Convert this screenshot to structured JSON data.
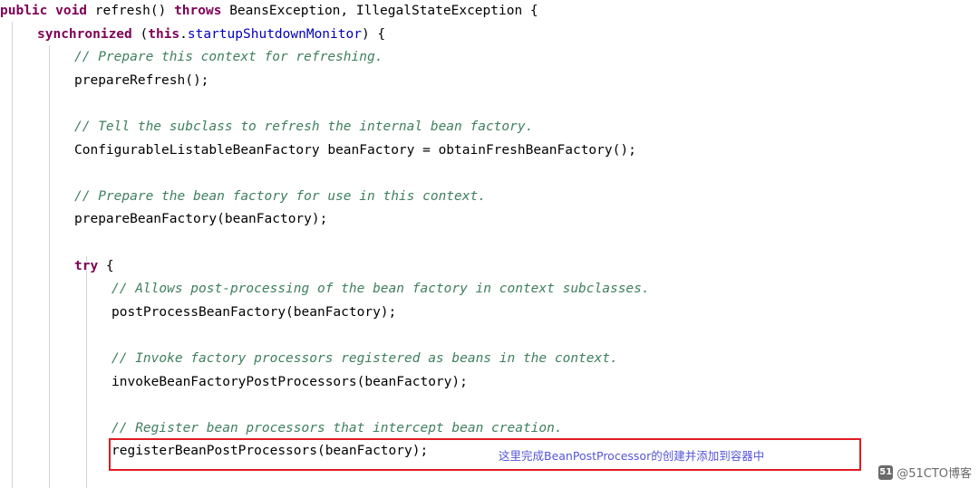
{
  "document": {
    "type": "java-source-code",
    "lines": [
      {
        "indent": 0,
        "segments": [
          {
            "style": "kw",
            "text": "public void "
          },
          {
            "style": "plain",
            "text": "refresh() "
          },
          {
            "style": "kw",
            "text": "throws "
          },
          {
            "style": "plain",
            "text": "BeansException, IllegalStateException {"
          }
        ]
      },
      {
        "indent": 1,
        "segments": [
          {
            "style": "kw",
            "text": "synchronized "
          },
          {
            "style": "plain",
            "text": "("
          },
          {
            "style": "kw",
            "text": "this"
          },
          {
            "style": "plain",
            "text": "."
          },
          {
            "style": "field",
            "text": "startupShutdownMonitor"
          },
          {
            "style": "plain",
            "text": ") {"
          }
        ]
      },
      {
        "indent": 2,
        "segments": [
          {
            "style": "cmt",
            "text": "// Prepare this context for refreshing."
          }
        ]
      },
      {
        "indent": 2,
        "segments": [
          {
            "style": "plain",
            "text": "prepareRefresh();"
          }
        ]
      },
      {
        "indent": 0,
        "segments": []
      },
      {
        "indent": 2,
        "segments": [
          {
            "style": "cmt",
            "text": "// Tell the subclass to refresh the internal bean factory."
          }
        ]
      },
      {
        "indent": 2,
        "segments": [
          {
            "style": "plain",
            "text": "ConfigurableListableBeanFactory beanFactory = obtainFreshBeanFactory();"
          }
        ]
      },
      {
        "indent": 0,
        "segments": []
      },
      {
        "indent": 2,
        "segments": [
          {
            "style": "cmt",
            "text": "// Prepare the bean factory for use in this context."
          }
        ]
      },
      {
        "indent": 2,
        "segments": [
          {
            "style": "plain",
            "text": "prepareBeanFactory(beanFactory);"
          }
        ]
      },
      {
        "indent": 0,
        "segments": []
      },
      {
        "indent": 2,
        "segments": [
          {
            "style": "kw",
            "text": "try "
          },
          {
            "style": "plain",
            "text": "{"
          }
        ]
      },
      {
        "indent": 3,
        "segments": [
          {
            "style": "cmt",
            "text": "// Allows post-processing of the bean factory in context subclasses."
          }
        ]
      },
      {
        "indent": 3,
        "segments": [
          {
            "style": "plain",
            "text": "postProcessBeanFactory(beanFactory);"
          }
        ]
      },
      {
        "indent": 0,
        "segments": []
      },
      {
        "indent": 3,
        "segments": [
          {
            "style": "cmt",
            "text": "// Invoke factory processors registered as beans in the context."
          }
        ]
      },
      {
        "indent": 3,
        "segments": [
          {
            "style": "plain",
            "text": "invokeBeanFactoryPostProcessors(beanFactory);"
          }
        ]
      },
      {
        "indent": 0,
        "segments": []
      },
      {
        "indent": 3,
        "segments": [
          {
            "style": "cmt",
            "text": "// Register bean processors that intercept bean creation."
          }
        ]
      },
      {
        "indent": 3,
        "segments": [
          {
            "style": "plain",
            "text": "registerBeanPostProcessors(beanFactory);"
          }
        ]
      }
    ]
  },
  "annotation": {
    "text": "这里完成BeanPostProcessor的创建并添加到容器中",
    "color": "#5555d8"
  },
  "highlight_box": {
    "color": "#e11b22"
  },
  "watermark": {
    "logo": "51",
    "text": "@51CTO博客"
  }
}
